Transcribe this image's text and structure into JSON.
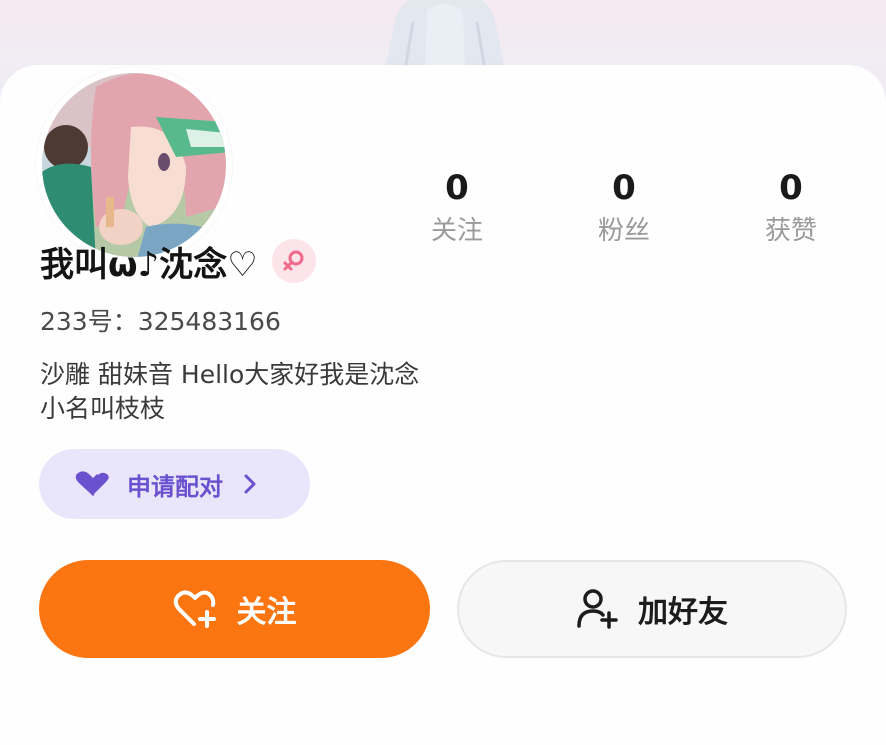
{
  "stats": {
    "following": {
      "value": "0",
      "label": "关注"
    },
    "fans": {
      "value": "0",
      "label": "粉丝"
    },
    "likes": {
      "value": "0",
      "label": "获赞"
    }
  },
  "profile": {
    "name": "我叫ω♪沈念♡",
    "gender_icon": "female-icon",
    "uid": "233号：325483166",
    "bio_line1": "沙雕 甜妹音 Hello大家好我是沈念",
    "bio_line2": "小名叫枝枝"
  },
  "pair_button": {
    "label": "申请配对",
    "icon": "heart-icon"
  },
  "actions": {
    "follow_label": "关注",
    "follow_icon": "heart-plus-icon",
    "add_friend_label": "加好友",
    "add_friend_icon": "user-plus-icon"
  },
  "colors": {
    "accent_orange": "#fb7511",
    "pair_bg": "#e9e6fb",
    "pair_text": "#6a52cf",
    "gender_badge_bg": "#fde4ea",
    "gender_symbol": "#f06a8c"
  }
}
